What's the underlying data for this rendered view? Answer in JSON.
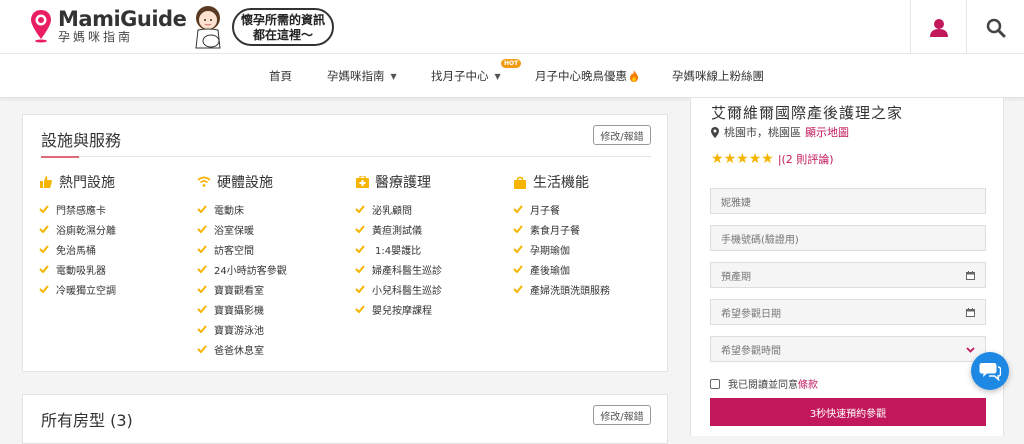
{
  "header": {
    "logo_name": "MamiGuide",
    "logo_sub": "孕媽咪指南",
    "bubble_line1": "懷孕所需的資訊",
    "bubble_line2": "都在這裡～",
    "brand_color": "#e91e63"
  },
  "nav": {
    "items": [
      {
        "label": "首頁"
      },
      {
        "label": "孕媽咪指南",
        "dropdown": true
      },
      {
        "label": "找月子中心",
        "dropdown": true,
        "badge": "HOT"
      },
      {
        "label": "月子中心晚鳥優惠",
        "icon": "fire-icon"
      },
      {
        "label": "孕媽咪線上粉絲團"
      }
    ]
  },
  "facilities": {
    "title": "設施與服務",
    "edit_label": "修改/報錯",
    "columns": [
      {
        "title": "熱門設施",
        "icon": "thumbs-up-icon",
        "items": [
          "門禁感應卡",
          "浴廁乾濕分離",
          "免治馬桶",
          "電動吸乳器",
          "冷暖獨立空調"
        ]
      },
      {
        "title": "硬體設施",
        "icon": "wifi-icon",
        "items": [
          "電動床",
          "浴室保暖",
          "訪客空間",
          "24小時訪客參觀",
          "寶寶觀看室",
          "寶寶攝影機",
          "寶寶游泳池",
          "爸爸休息室"
        ]
      },
      {
        "title": "醫療護理",
        "icon": "medical-kit-icon",
        "items": [
          "泌乳顧問",
          "黃疸測試儀",
          "1:4嬰護比",
          "婦產科醫生巡診",
          "小兒科醫生巡診",
          "嬰兒按摩課程"
        ]
      },
      {
        "title": "生活機能",
        "icon": "shopping-bag-icon",
        "items": [
          "月子餐",
          "素食月子餐",
          "孕期瑜伽",
          "產後瑜伽",
          "產婦洗頭洗頭服務"
        ]
      }
    ]
  },
  "rooms": {
    "title": "所有房型",
    "count": "(3)",
    "edit_label": "修改/報錯"
  },
  "sidebar": {
    "name": "艾爾維爾國際產後護理之家",
    "location": "桃園市，桃園區",
    "map_link": "顯示地圖",
    "rating_stars": 5,
    "reviews": "|(2 則評論)",
    "form": {
      "name_placeholder": "妮雅婕",
      "phone_placeholder": "手機號碼(驗證用)",
      "due_date_placeholder": "預產期",
      "visit_date_placeholder": "希望參觀日期",
      "visit_time_placeholder": "希望參觀時間",
      "agree_text": "我已閱讀並同意",
      "terms_link": "條款",
      "submit_label": "3秒快速預約參觀"
    }
  }
}
